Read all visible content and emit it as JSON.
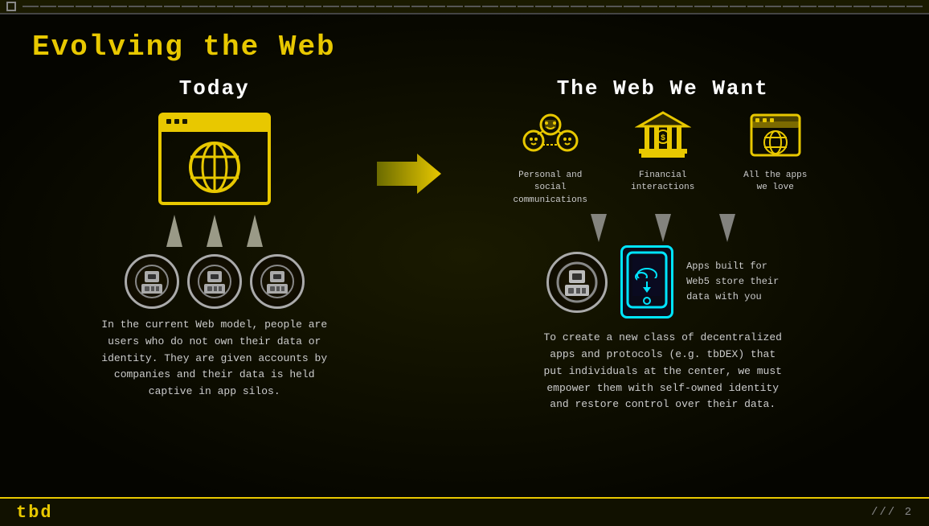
{
  "topbar": {
    "square": "□"
  },
  "title": "Evolving the Web",
  "left": {
    "section_title": "Today",
    "description": "In the current Web model, people are\nusers who do not own their data or\nidentity. They are given accounts by\ncompanies and their data is held\ncaptive in app silos."
  },
  "right": {
    "section_title": "The  Web  We  Want",
    "icons": [
      {
        "id": "social",
        "label": "Personal and social\ncommunications"
      },
      {
        "id": "financial",
        "label": "Financial\ninteractions"
      },
      {
        "id": "apps",
        "label": "All the apps\nwe love"
      }
    ],
    "bottom_label": "Apps built for\nWeb5 store their\ndata with you",
    "description": "To create a new class of decentralized\napps and protocols (e.g. tbDEX) that\nput individuals at the center, we must\nempower them with self-owned identity\nand restore control over their data."
  },
  "bottom": {
    "logo": "tbd",
    "page_info": "/// 2"
  }
}
